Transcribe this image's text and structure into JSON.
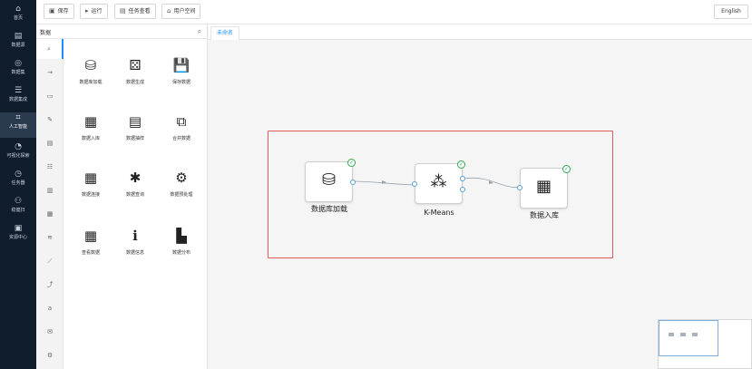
{
  "nav": {
    "items": [
      {
        "label": "首页",
        "icon": "home-icon",
        "glyph": "⌂"
      },
      {
        "label": "数据源",
        "icon": "database-icon",
        "glyph": "▤"
      },
      {
        "label": "数据集",
        "icon": "dataset-icon",
        "glyph": "◎"
      },
      {
        "label": "数据集成",
        "icon": "integration-icon",
        "glyph": "☰"
      },
      {
        "label": "人工智能",
        "icon": "ai-icon",
        "glyph": "⌗"
      },
      {
        "label": "可视化探索",
        "icon": "visualization-icon",
        "glyph": "◔"
      },
      {
        "label": "任务器",
        "icon": "task-icon",
        "glyph": "◷"
      },
      {
        "label": "稳健扫",
        "icon": "network-icon",
        "glyph": "⚇"
      },
      {
        "label": "资源中心",
        "icon": "resource-icon",
        "glyph": "▣"
      }
    ],
    "active_index": 4
  },
  "toolbar": {
    "save_label": "保存",
    "run_label": "运行",
    "task_view_label": "任务查看",
    "user_space_label": "用户空间",
    "language_label": "English"
  },
  "panel": {
    "search_value": "数据",
    "categories": [
      {
        "icon": "search-icon",
        "glyph": "⌕"
      },
      {
        "icon": "arrow-icon",
        "glyph": "→"
      },
      {
        "icon": "table-icon",
        "glyph": "▭"
      },
      {
        "icon": "pen-icon",
        "glyph": "✎"
      },
      {
        "icon": "card-icon",
        "glyph": "▤"
      },
      {
        "icon": "list-icon",
        "glyph": "☷"
      },
      {
        "icon": "bar-chart-icon",
        "glyph": "▥"
      },
      {
        "icon": "column-icon",
        "glyph": "▦"
      },
      {
        "icon": "stack-icon",
        "glyph": "≋"
      },
      {
        "icon": "line-chart-icon",
        "glyph": "⟋"
      },
      {
        "icon": "trend-icon",
        "glyph": "⤴"
      },
      {
        "icon": "text-icon",
        "glyph": "a"
      },
      {
        "icon": "chat-icon",
        "glyph": "✉"
      },
      {
        "icon": "settings-icon",
        "glyph": "⚙"
      }
    ],
    "components": [
      {
        "label": "数据库加载",
        "icon": "database-load-icon",
        "glyph": "⛁"
      },
      {
        "label": "数据生成",
        "icon": "dice-icon",
        "glyph": "⚄"
      },
      {
        "label": "保存数据",
        "icon": "floppy-icon",
        "glyph": "💾"
      },
      {
        "label": "数据入库",
        "icon": "table-import-icon",
        "glyph": "▦"
      },
      {
        "label": "数据抽样",
        "icon": "sample-icon",
        "glyph": "▤"
      },
      {
        "label": "合并数据",
        "icon": "merge-icon",
        "glyph": "⧉"
      },
      {
        "label": "数据连接",
        "icon": "join-icon",
        "glyph": "▦"
      },
      {
        "label": "数据查询",
        "icon": "query-icon",
        "glyph": "✱"
      },
      {
        "label": "数据预处理",
        "icon": "preprocess-icon",
        "glyph": "⚙"
      },
      {
        "label": "查看数据",
        "icon": "view-table-icon",
        "glyph": "▦"
      },
      {
        "label": "数据信息",
        "icon": "info-icon",
        "glyph": "ℹ"
      },
      {
        "label": "数据分布",
        "icon": "distribution-icon",
        "glyph": "▙"
      }
    ]
  },
  "canvas": {
    "tab_label": "未命名",
    "nodes": [
      {
        "label": "数据库加载",
        "icon": "database-icon",
        "glyph": "⛁"
      },
      {
        "label": "K-Means",
        "icon": "kmeans-icon",
        "glyph": "⁂"
      },
      {
        "label": "数据入库",
        "icon": "table-import-icon",
        "glyph": "▦"
      }
    ],
    "check_glyph": "✓"
  },
  "colors": {
    "nav_bg": "#0f1d2d",
    "accent": "#1890ff",
    "selection": "#e25a5a",
    "success": "#2fa84f"
  }
}
